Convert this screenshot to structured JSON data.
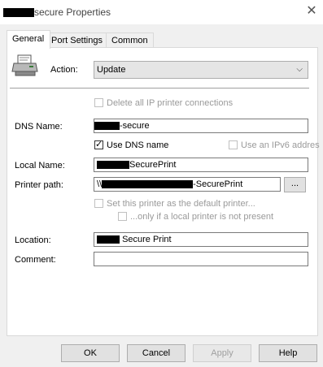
{
  "window": {
    "title": "secure Properties",
    "close_icon": "close-icon"
  },
  "tabs": [
    {
      "label": "General",
      "active": true
    },
    {
      "label": "Port Settings",
      "active": false
    },
    {
      "label": "Common",
      "active": false
    }
  ],
  "general": {
    "action_label": "Action:",
    "action_value": "Update",
    "delete_all_ip_label": "Delete all IP printer connections",
    "dns_name_label": "DNS Name:",
    "dns_name_value": "-secure",
    "use_dns_name_label": "Use DNS name",
    "use_dns_name_checked": true,
    "use_ipv6_label": "Use an IPv6 addres",
    "local_name_label": "Local Name:",
    "local_name_value": "SecurePrint",
    "printer_path_label": "Printer path:",
    "printer_path_prefix": "\\\\",
    "printer_path_value": "-SecurePrint",
    "browse_label": "...",
    "default_printer_label": "Set this printer as the default printer...",
    "only_if_local_label": "...only if a local printer is not present",
    "location_label": "Location:",
    "location_value": "Secure Print",
    "comment_label": "Comment:",
    "comment_value": ""
  },
  "buttons": {
    "ok": "OK",
    "cancel": "Cancel",
    "apply": "Apply",
    "help": "Help"
  }
}
